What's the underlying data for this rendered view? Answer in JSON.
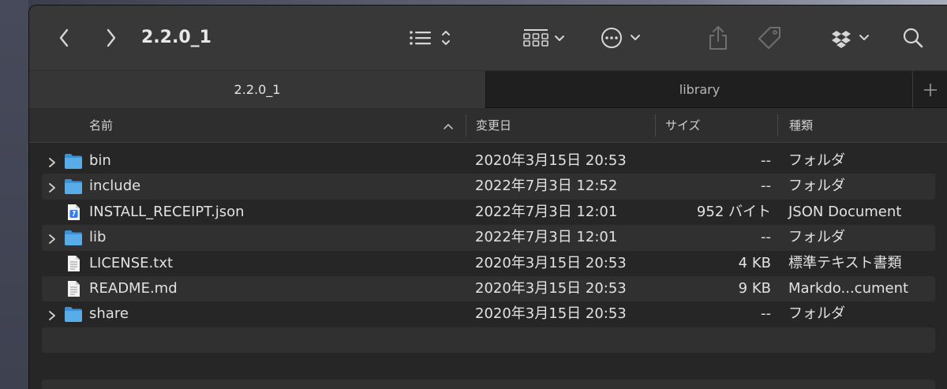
{
  "window": {
    "title": "2.2.0_1"
  },
  "tabs": [
    {
      "label": "2.2.0_1",
      "active": true
    },
    {
      "label": "library",
      "active": false
    }
  ],
  "columns": {
    "name": "名前",
    "modified": "変更日",
    "size": "サイズ",
    "kind": "種類"
  },
  "files": [
    {
      "name": "bin",
      "date": "2020年3月15日 20:53",
      "size": "--",
      "kind": "フォルダ",
      "type": "folder"
    },
    {
      "name": "include",
      "date": "2022年7月3日 12:52",
      "size": "--",
      "kind": "フォルダ",
      "type": "folder"
    },
    {
      "name": "INSTALL_RECEIPT.json",
      "date": "2022年7月3日 12:01",
      "size": "952 バイト",
      "kind": "JSON Document",
      "type": "json"
    },
    {
      "name": "lib",
      "date": "2022年7月3日 12:01",
      "size": "--",
      "kind": "フォルダ",
      "type": "folder"
    },
    {
      "name": "LICENSE.txt",
      "date": "2020年3月15日 20:53",
      "size": "4 KB",
      "kind": "標準テキスト書類",
      "type": "text"
    },
    {
      "name": "README.md",
      "date": "2020年3月15日 20:53",
      "size": "9 KB",
      "kind": "Markdo...cument",
      "type": "text"
    },
    {
      "name": "share",
      "date": "2020年3月15日 20:53",
      "size": "--",
      "kind": "フォルダ",
      "type": "folder"
    }
  ],
  "icons": {
    "back": "chevron-left-icon",
    "forward": "chevron-right-icon",
    "list_view": "list-view-icon",
    "group": "group-grid-icon",
    "more": "ellipsis-circle-icon",
    "share": "share-icon",
    "tag": "tag-icon",
    "dropbox": "dropbox-icon",
    "search": "search-icon",
    "add_tab": "plus-icon"
  },
  "colors": {
    "folder": "#4fa6e6",
    "accent": "#2f7cf6"
  }
}
